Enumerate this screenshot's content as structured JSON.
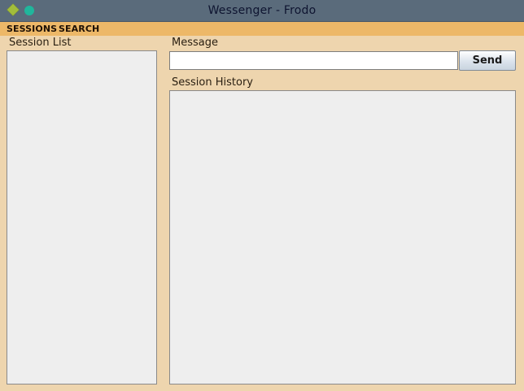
{
  "window": {
    "title": "Wessenger - Frodo",
    "controls": [
      "diamond-icon",
      "circle-icon"
    ],
    "colors": {
      "titlebar": "#5a6b7b",
      "menubar": "#edb868",
      "background": "#eed5ae"
    }
  },
  "menu": {
    "sessions": "SESSIONS",
    "search": "SEARCH"
  },
  "session_list": {
    "label": "Session List",
    "items": []
  },
  "message": {
    "label": "Message",
    "value": "",
    "send_label": "Send"
  },
  "history": {
    "label": "Session History",
    "entries": []
  }
}
